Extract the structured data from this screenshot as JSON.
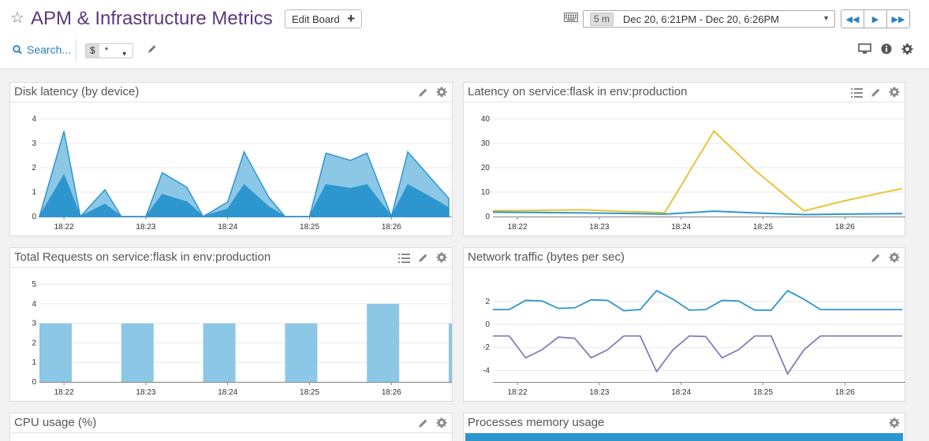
{
  "header": {
    "title": "APM & Infrastructure Metrics",
    "edit_board_label": "Edit Board",
    "time_span": "5 m",
    "time_range": "Dec 20, 6:21PM - Dec 20, 6:26PM",
    "search_label": "Search...",
    "template_var_prefix": "$",
    "template_var_value": "*"
  },
  "widgets": [
    {
      "title": "Disk latency (by device)"
    },
    {
      "title": "Latency on service:flask in env:production"
    },
    {
      "title": "Total Requests on service:flask in env:production"
    },
    {
      "title": "Network traffic (bytes per sec)"
    },
    {
      "title": "CPU usage (%)"
    },
    {
      "title": "Processes memory usage"
    }
  ],
  "colors": {
    "accent": "#2b7fc3",
    "title": "#5a3a7e",
    "series_blue": "#2e96cf",
    "series_blue_light": "#8cc8e5",
    "series_yellow": "#e8c33c",
    "series_purple": "#8c79b7"
  },
  "chart_data": [
    {
      "type": "area",
      "title": "Disk latency (by device)",
      "x_ticks": [
        "18:22",
        "18:23",
        "18:24",
        "18:25",
        "18:26"
      ],
      "x_tick_index": [
        3,
        13,
        23,
        33,
        43
      ],
      "ylim": [
        0,
        4
      ],
      "y_ticks": [
        0,
        1,
        2,
        3,
        4
      ],
      "series": [
        {
          "values": [
            0,
            3.5,
            0,
            1.1,
            0,
            0,
            1.8,
            1.2,
            0,
            0.6,
            2.65,
            0.8,
            0,
            0,
            2.6,
            2.3,
            2.6,
            0,
            2.65,
            1.5,
            0.75
          ]
        },
        {
          "values": [
            0,
            1.7,
            0,
            0.5,
            0,
            0,
            0.9,
            0.6,
            0,
            0.3,
            1.3,
            0.4,
            0,
            0,
            1.3,
            1.15,
            1.3,
            0,
            1.3,
            0.75,
            0.35
          ]
        }
      ],
      "x_index": [
        0,
        3,
        5,
        8,
        10,
        13,
        15,
        18,
        20,
        23,
        25,
        28,
        30,
        33,
        35,
        38,
        40,
        43,
        45,
        48,
        50
      ]
    },
    {
      "type": "line",
      "title": "Latency on service:flask in env:production",
      "x_ticks": [
        "18:22",
        "18:23",
        "18:24",
        "18:25",
        "18:26"
      ],
      "x_tick_index": [
        3,
        13,
        23,
        33,
        43
      ],
      "ylim": [
        0,
        40
      ],
      "y_ticks": [
        0,
        10,
        20,
        30,
        40
      ],
      "x_index": [
        0,
        5,
        11,
        16,
        21,
        27,
        32,
        38,
        43,
        50
      ],
      "series": [
        {
          "values": [
            2.4,
            2.5,
            2.8,
            2.1,
            1.6,
            35,
            19,
            2.3,
            6.5,
            11.5
          ]
        },
        {
          "values": [
            1.8,
            1.7,
            1.5,
            1.3,
            1.0,
            2.2,
            1.5,
            0.8,
            1.0,
            1.2
          ]
        }
      ]
    },
    {
      "type": "bar",
      "title": "Total Requests on service:flask in env:production",
      "x_ticks": [
        "18:22",
        "18:23",
        "18:24",
        "18:25",
        "18:26"
      ],
      "x_tick_index": [
        3,
        13,
        23,
        33,
        43
      ],
      "ylim": [
        0,
        5
      ],
      "y_ticks": [
        0,
        1,
        2,
        3,
        4,
        5
      ],
      "values": [
        3,
        3,
        3,
        3,
        4,
        3
      ],
      "bar_index": [
        0,
        10,
        20,
        30,
        40,
        50
      ]
    },
    {
      "type": "line",
      "title": "Network traffic (bytes per sec)",
      "x_ticks": [
        "18:22",
        "18:23",
        "18:24",
        "18:25",
        "18:26"
      ],
      "x_tick_index": [
        3,
        13,
        23,
        33,
        43
      ],
      "ylim": [
        -5,
        3.5
      ],
      "y_ticks": [
        -4,
        -2,
        0,
        2
      ],
      "x_index": [
        0,
        2,
        4,
        6,
        8,
        10,
        12,
        14,
        16,
        18,
        20,
        22,
        24,
        26,
        28,
        30,
        32,
        34,
        36,
        38,
        40,
        42,
        44,
        46,
        48,
        50
      ],
      "series": [
        {
          "values": [
            1.3,
            1.3,
            2.1,
            2.05,
            1.4,
            1.45,
            2.15,
            2.1,
            1.2,
            1.3,
            2.95,
            2.2,
            1.25,
            1.3,
            2.1,
            2.05,
            1.25,
            1.25,
            2.95,
            2.2,
            1.3,
            1.3,
            1.3,
            1.3,
            1.3,
            1.3
          ]
        },
        {
          "values": [
            -1.0,
            -1.0,
            -2.9,
            -2.2,
            -1.1,
            -1.2,
            -2.9,
            -2.2,
            -1.0,
            -1.0,
            -4.1,
            -2.2,
            -1.0,
            -1.05,
            -2.9,
            -2.2,
            -1.0,
            -1.0,
            -4.3,
            -2.2,
            -1.0,
            -1.0,
            -1.0,
            -1.0,
            -1.0,
            -1.0
          ]
        }
      ]
    }
  ]
}
